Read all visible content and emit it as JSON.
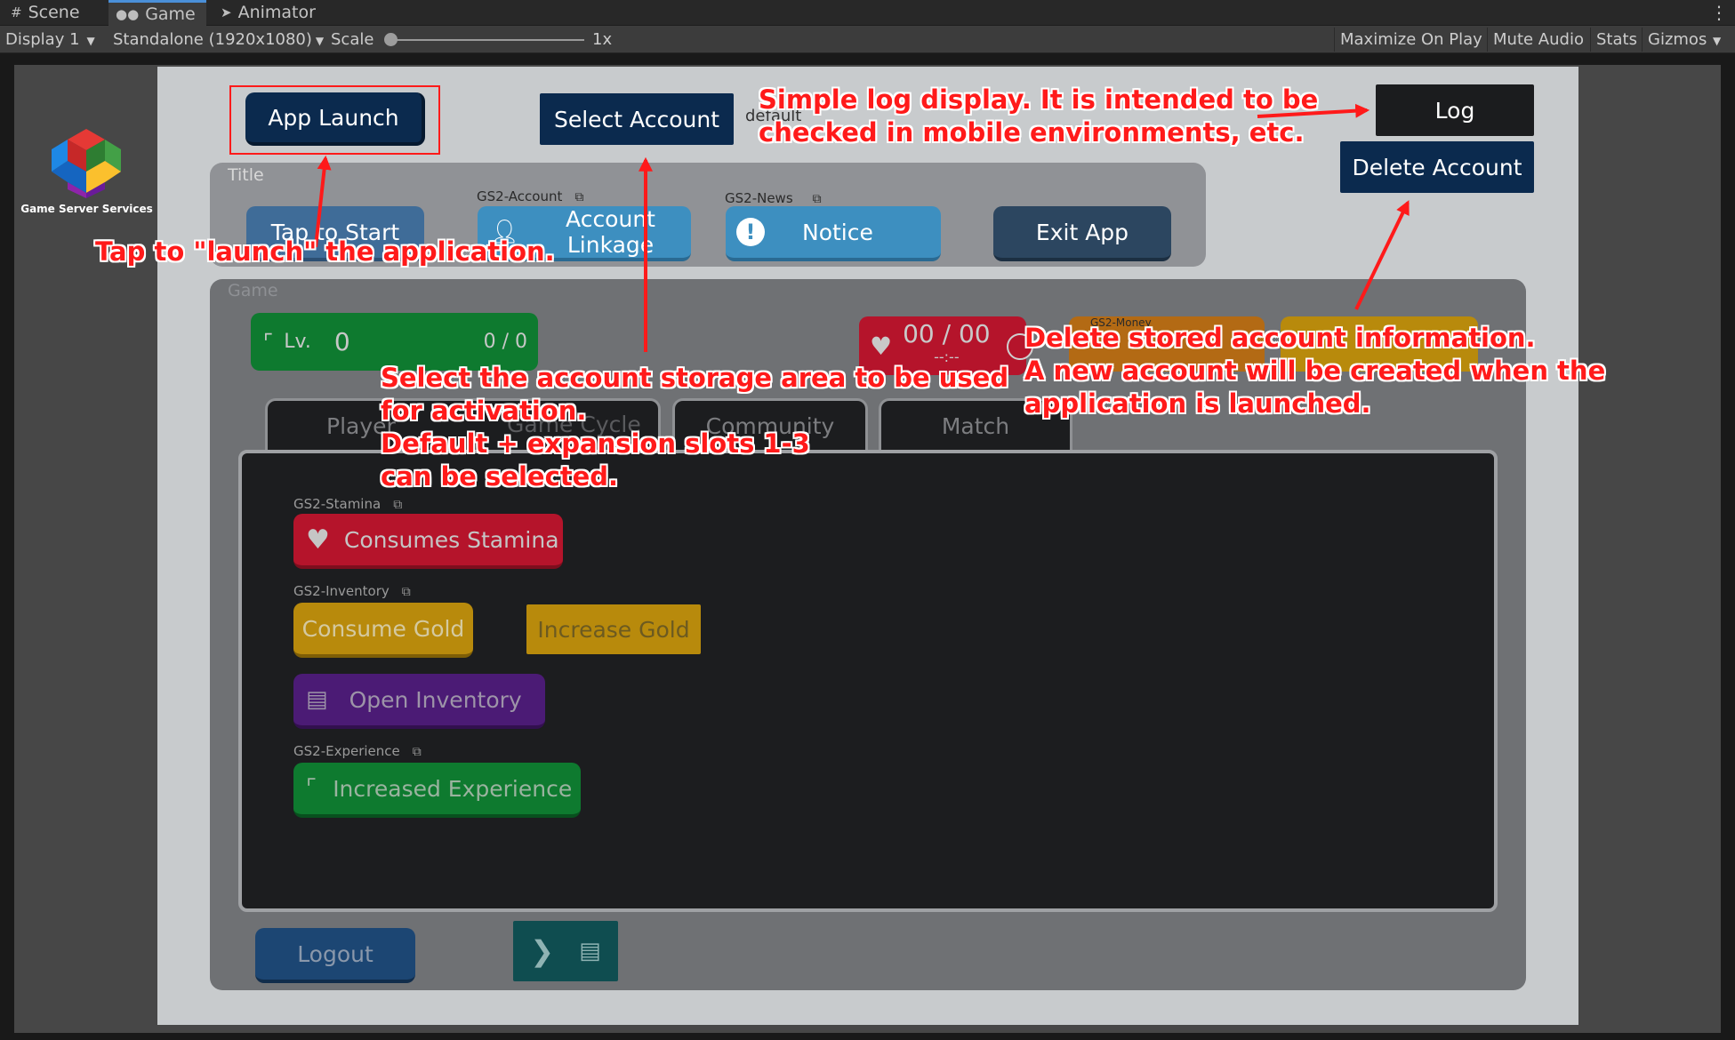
{
  "editor": {
    "tabs": [
      {
        "label": "Scene",
        "icon": "grid-icon"
      },
      {
        "label": "Game",
        "icon": "gamepad-icon"
      },
      {
        "label": "Animator",
        "icon": "animator-icon"
      }
    ],
    "toolbar": {
      "display": "Display 1",
      "resolution": "Standalone (1920x1080)",
      "scale_label": "Scale",
      "scale_value": "1x",
      "maximize": "Maximize On Play",
      "mute": "Mute Audio",
      "stats": "Stats",
      "gizmos": "Gizmos"
    }
  },
  "logo": {
    "text": "Game Server Services"
  },
  "game": {
    "app_launch": "App Launch",
    "select_account": "Select Account",
    "select_account_hint": "default",
    "log": "Log",
    "delete_account": "Delete Account",
    "title_panel": {
      "label": "Title",
      "tap_to_start": "Tap to Start",
      "account_label": "GS2-Account",
      "account_linkage": "Account Linkage",
      "news_label": "GS2-News",
      "notice": "Notice",
      "exit_app": "Exit App"
    },
    "game_panel": {
      "label": "Game",
      "level_prefix": "Lv.",
      "level": "0",
      "exp": "0 / 0",
      "stamina": "00 / 00",
      "stamina_timer": "--:--",
      "money_label": "GS2-Money",
      "tabs": [
        "Player",
        "Game Cycle",
        "Community",
        "Match"
      ],
      "stamina_section": "GS2-Stamina",
      "consume_stamina": "Consumes Stamina",
      "inventory_section": "GS2-Inventory",
      "consume_gold": "Consume Gold",
      "increase_gold": "Increase Gold",
      "open_inventory": "Open Inventory",
      "experience_section": "GS2-Experience",
      "increase_experience": "Increased Experience",
      "logout": "Logout"
    }
  },
  "annotations": {
    "log_note": [
      "Simple log display. It is intended to be",
      "checked in mobile environments, etc."
    ],
    "launch_note": "Tap to \"launch\" the application.",
    "select_note": [
      "Select the account storage area to be used",
      "for activation.",
      "Default + expansion slots 1-3",
      "can be selected."
    ],
    "delete_note": [
      "Delete stored account information.",
      "A new account will be created when the",
      "application is launched."
    ]
  },
  "colors": {
    "dark_navy": "#0b2a4e",
    "annotation_red": "#ff1a1a",
    "stamina_red": "#b5142b",
    "gold": "#b88a0c",
    "purple": "#4b1b75",
    "green": "#0e7a2f",
    "blue": "#3d8fc0"
  }
}
